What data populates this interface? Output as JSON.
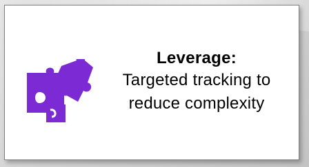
{
  "card": {
    "title": "Leverage:",
    "lines": [
      "Targeted tracking to",
      "reduce complexity"
    ]
  },
  "icon": {
    "name": "puzzle-pieces-icon",
    "color": "#7c2bd4"
  }
}
